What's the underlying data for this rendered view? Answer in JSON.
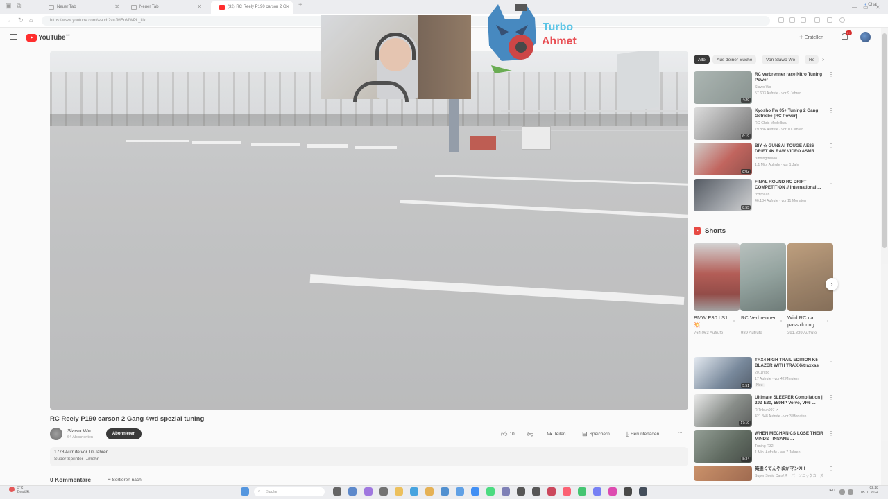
{
  "browser": {
    "tabs": [
      {
        "label": "Neuer Tab",
        "active": false
      },
      {
        "label": "Neuer Tab",
        "active": false
      },
      {
        "label": "(32) RC Reely P190 carson 2 G",
        "active": true
      }
    ],
    "new_tab": "+",
    "url": "https://www.youtube.com/watch?v=JMEnMWPL_Uk",
    "copilot_label": "Chat"
  },
  "youtube": {
    "logo_text": "YouTube",
    "logo_country": "DE",
    "create_label": "Erstellen",
    "notif_count": "9+"
  },
  "overlay": {
    "turbo": "Turbo",
    "ahmet": "Ahmet"
  },
  "video": {
    "title": "RC Reely P190 carson 2 Gang 4wd spezial tuning",
    "channel": "Slawo Wo",
    "subscribers": "64 Abonnenten",
    "subscribe_label": "Abonnieren",
    "likes": "10",
    "share_label": "Teilen",
    "save_label": "Speichern",
    "download_label": "Herunterladen",
    "more_label": "···",
    "views_line": "1778 Aufrufe  vor 10 Jahren",
    "desc_line": "Super Sprinter ...mehr",
    "comments_label": "0 Kommentare",
    "sort_label": "Sortieren nach"
  },
  "sidebar": {
    "chips": [
      "Alle",
      "Aus deiner Suche",
      "Von Slawo Wo",
      "Re"
    ],
    "recommendations_top": [
      {
        "title": "RC verbrenner race Nitro Tuning Power",
        "channel": "Slawo Wo",
        "meta": "57.603 Aufrufe · vor 9 Jahren",
        "duration": "4:20",
        "thumb": "#8d9a96"
      },
      {
        "title": "Kyosho Fw 05+ Tuning 2 Gang Getriebe [RC Power]",
        "channel": "RC-Chris Modellbau",
        "meta": "79.836 Aufrufe · vor 10 Jahren",
        "duration": "6:19",
        "thumb": "#6c6f72"
      },
      {
        "title": "BIY ☆ GUNSAI TOUGE AE86 DRIFT 4K RAW VIDEO ASMR ...",
        "channel": "runningfree88",
        "meta": "1,1 Mio. Aufrufe · vor 1 Jahr",
        "duration": "8:02",
        "thumb": "#b4443c"
      },
      {
        "title": "FINAL ROUND RC DRIFT COMPETITION // International ...",
        "channel": "rcdjmaan",
        "meta": "46.184 Aufrufe · vor 11 Monaten",
        "duration": "8:55",
        "thumb": "#4a4f57"
      }
    ],
    "shorts_title": "Shorts",
    "shorts": [
      {
        "title": "BMW E30 LS1 💥 ...",
        "views": "764.063 Aufrufe",
        "thumb": "#a33a32"
      },
      {
        "title": "RC Verbrenner ...",
        "views": "989 Aufrufe",
        "thumb": "#7c8f8a"
      },
      {
        "title": "Wild RC car pass during...",
        "views": "391.839 Aufrufe",
        "thumb": "#8a6a4a"
      }
    ],
    "recommendations_bottom": [
      {
        "title": "TRX4 HIGH TRAIL EDITION K5 BLAZER WITH TRAXX#traxxas",
        "channel": "2011rcpc",
        "meta": "17 Aufrufe · vor 42 Minuten",
        "extra": "Neu",
        "duration": "5:51",
        "thumb": "#5b6f86"
      },
      {
        "title": "Ultimate SLEEPER Compilation | 2JZ E30, 559HP Volvo, VR6 ...",
        "channel": "R.Tribun997 ✔",
        "meta": "421.348 Aufrufe · vor 3 Monaten",
        "extra": "",
        "duration": "17:10",
        "thumb": "#6f7570"
      },
      {
        "title": "WHEN MECHANICS LOSE THEIR MINDS –INSANE ...",
        "channel": "Tuning R32",
        "meta": "1 Mio. Aufrufe · vor 7 Jahren",
        "extra": "",
        "duration": "8:34",
        "thumb": "#3d4a3e"
      },
      {
        "title": "俺達くてんやまかマン?! !",
        "channel": "Super Sonic Cars/ス一パ一ソニックカ一ズ",
        "meta": "",
        "extra": "",
        "duration": "",
        "thumb": "#8a4a2a"
      }
    ]
  },
  "taskbar": {
    "weather_temp": "3°C",
    "weather_desc": "Bewölkt",
    "search_placeholder": "Suche",
    "lang": "DEU",
    "time": "02:28",
    "date": "05.01.2024"
  },
  "colors": {
    "yt_red": "#ff0000",
    "turbo_blue": "#37b8e0",
    "ahmet_red": "#e3262d",
    "subscribe_bg": "#0f0f0f"
  }
}
